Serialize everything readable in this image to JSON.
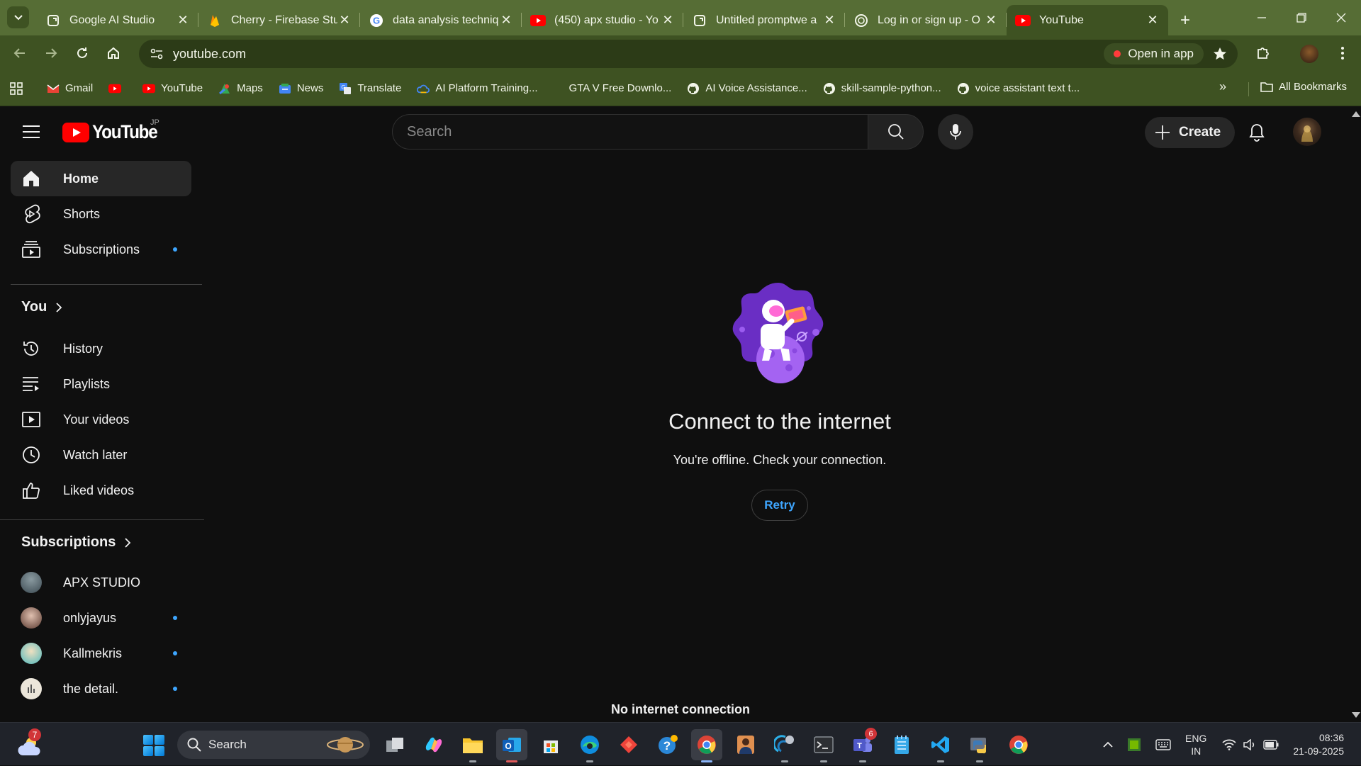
{
  "browser": {
    "tabs": [
      {
        "title": "Google AI Studio",
        "icon": "google-ai-studio-icon"
      },
      {
        "title": "Cherry - Firebase Stu",
        "icon": "firebase-icon"
      },
      {
        "title": "data analysis techniq",
        "icon": "google-icon"
      },
      {
        "title": "(450) apx studio - Yo",
        "icon": "youtube-icon"
      },
      {
        "title": "Untitled promptwe a",
        "icon": "google-ai-studio-icon"
      },
      {
        "title": "Log in or sign up - O",
        "icon": "openai-icon"
      },
      {
        "title": "YouTube",
        "icon": "youtube-icon",
        "active": true
      }
    ],
    "url": "youtube.com",
    "open_in_app": "Open in app",
    "bookmarks": [
      {
        "label": "Gmail",
        "icon": "gmail-icon"
      },
      {
        "label": "",
        "icon": "youtube-icon"
      },
      {
        "label": "YouTube",
        "icon": "youtube-icon"
      },
      {
        "label": "Maps",
        "icon": "maps-icon"
      },
      {
        "label": "News",
        "icon": "news-icon"
      },
      {
        "label": "Translate",
        "icon": "translate-icon"
      },
      {
        "label": "AI Platform Training...",
        "icon": "cloud-icon"
      },
      {
        "label": "GTA V Free Downlo...",
        "icon": "blank-icon"
      },
      {
        "label": "AI Voice Assistance...",
        "icon": "github-icon"
      },
      {
        "label": "skill-sample-python...",
        "icon": "github-icon"
      },
      {
        "label": "voice assistant text t...",
        "icon": "github-icon"
      }
    ],
    "all_bookmarks": "All Bookmarks"
  },
  "youtube": {
    "logo_text": "YouTube",
    "country": "JP",
    "search_placeholder": "Search",
    "create_label": "Create",
    "nav": [
      {
        "label": "Home",
        "icon": "home-icon",
        "active": true
      },
      {
        "label": "Shorts",
        "icon": "shorts-icon"
      },
      {
        "label": "Subscriptions",
        "icon": "subscriptions-icon",
        "dot": true
      }
    ],
    "you_title": "You",
    "you_items": [
      {
        "label": "History",
        "icon": "history-icon"
      },
      {
        "label": "Playlists",
        "icon": "playlists-icon"
      },
      {
        "label": "Your videos",
        "icon": "your-videos-icon"
      },
      {
        "label": "Watch later",
        "icon": "watch-later-icon"
      },
      {
        "label": "Liked videos",
        "icon": "liked-videos-icon"
      }
    ],
    "subscriptions_title": "Subscriptions",
    "subscriptions": [
      {
        "label": "APX STUDIO",
        "dot": false,
        "color": "#5a6b73"
      },
      {
        "label": "onlyjayus",
        "dot": true,
        "color": "#8a6a5c"
      },
      {
        "label": "Kallmekris",
        "dot": true,
        "color": "#6cc6c9"
      },
      {
        "label": "the detail.",
        "dot": true,
        "color": "#e8e2d5"
      }
    ],
    "offline_title": "Connect to the internet",
    "offline_subtitle": "You're offline. Check your connection.",
    "retry_label": "Retry",
    "no_connection": "No internet connection"
  },
  "taskbar": {
    "weather_badge": "7",
    "search_label": "Search",
    "teams_badge": "6",
    "lang_line1": "ENG",
    "lang_line2": "IN",
    "time": "08:36",
    "date": "21-09-2025"
  },
  "colors": {
    "chrome_frame": "#566d35",
    "chrome_toolbar": "#3e5222",
    "yt_background": "#0f0f0f",
    "yt_red": "#ff0000",
    "link_blue": "#3ea6ff"
  }
}
